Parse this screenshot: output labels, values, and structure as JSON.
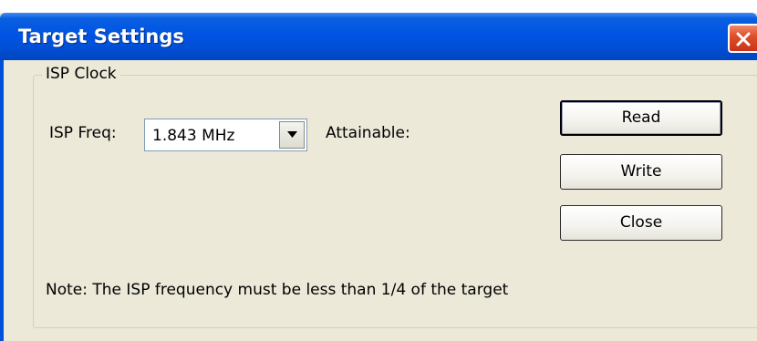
{
  "window": {
    "title": "Target Settings"
  },
  "isp_clock": {
    "group_label": "ISP Clock",
    "freq_label": "ISP Freq:",
    "freq_value": "1.843 MHz",
    "attainable_label": "Attainable:",
    "note": "Note: The ISP frequency must be less than 1/4 of the target"
  },
  "buttons": {
    "read": "Read",
    "write": "Write",
    "close": "Close"
  },
  "colors": {
    "titlebar": "#0054e3",
    "close_button": "#e0502a",
    "dialog_face": "#ece9d8"
  }
}
